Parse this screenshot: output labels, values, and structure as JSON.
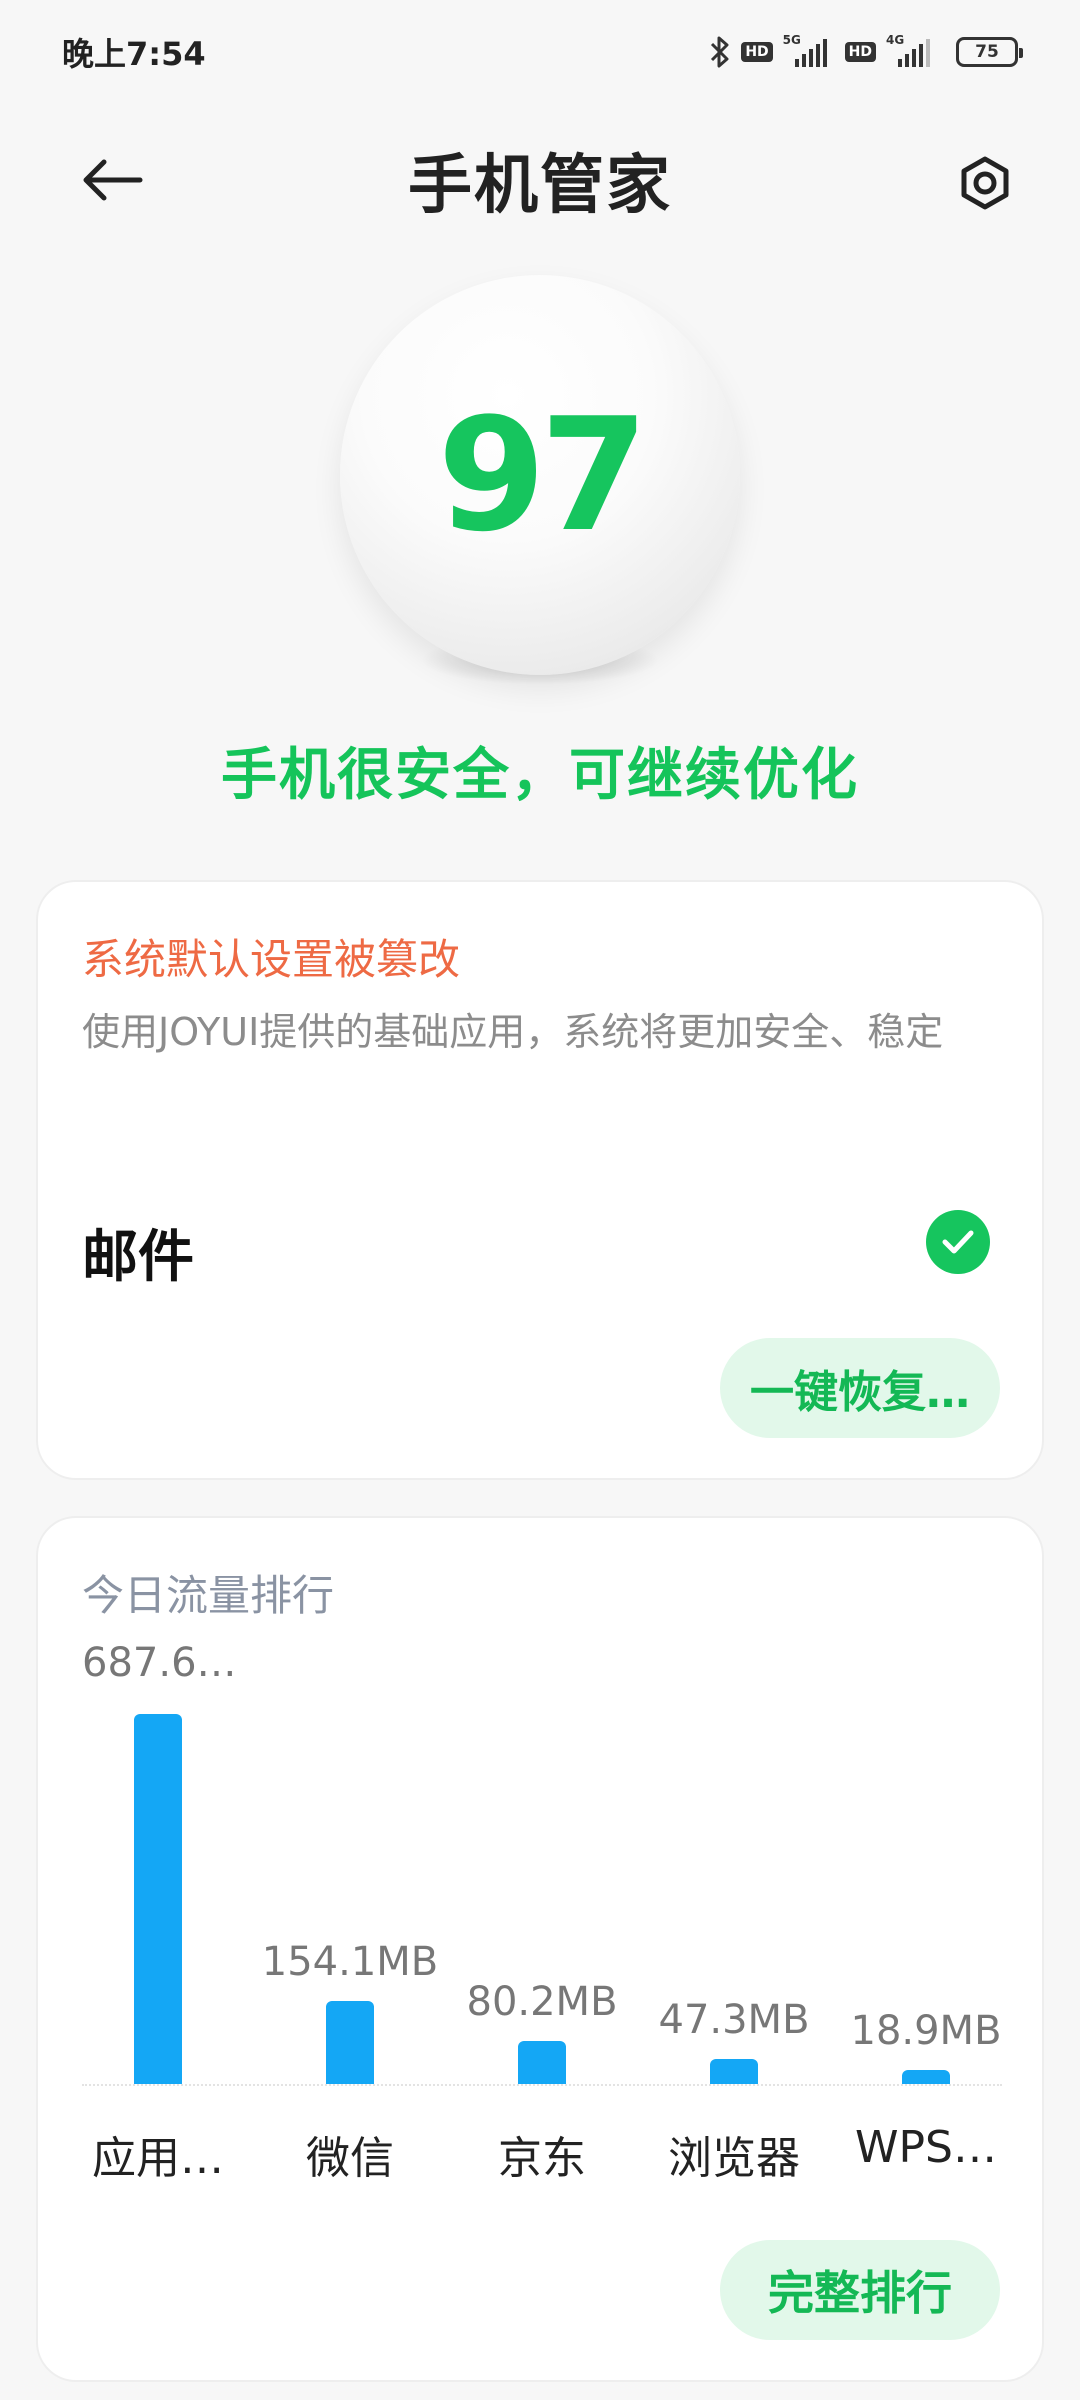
{
  "status_bar": {
    "time": "晚上7:54",
    "hd1": "HD",
    "net1": "5G",
    "hd2": "HD",
    "net2": "4G",
    "battery": "75"
  },
  "header": {
    "title": "手机管家",
    "back_icon": "arrow-left-icon",
    "settings_icon": "hexagon-settings-icon"
  },
  "score": {
    "value": "97",
    "message": "手机很安全，可继续优化",
    "color": "#16c55e"
  },
  "default_settings_card": {
    "warning_title": "系统默认设置被篡改",
    "warning_color": "#ee6a44",
    "description": "使用JOYUI提供的基础应用，系统将更加安全、稳定",
    "item_label": "邮件",
    "item_checked": true,
    "restore_button": "一键恢复…"
  },
  "traffic_card": {
    "title": "今日流量排行",
    "full_rank_button": "完整排行"
  },
  "chart_data": {
    "type": "bar",
    "title": "今日流量排行",
    "categories": [
      "应用…",
      "微信",
      "京东",
      "浏览器",
      "WPS…"
    ],
    "value_labels": [
      "687.6…",
      "154.1MB",
      "80.2MB",
      "47.3MB",
      "18.9MB"
    ],
    "values": [
      687.6,
      154.1,
      80.2,
      47.3,
      18.9
    ],
    "unit": "MB",
    "bar_color": "#14a7f5",
    "grid": false
  }
}
